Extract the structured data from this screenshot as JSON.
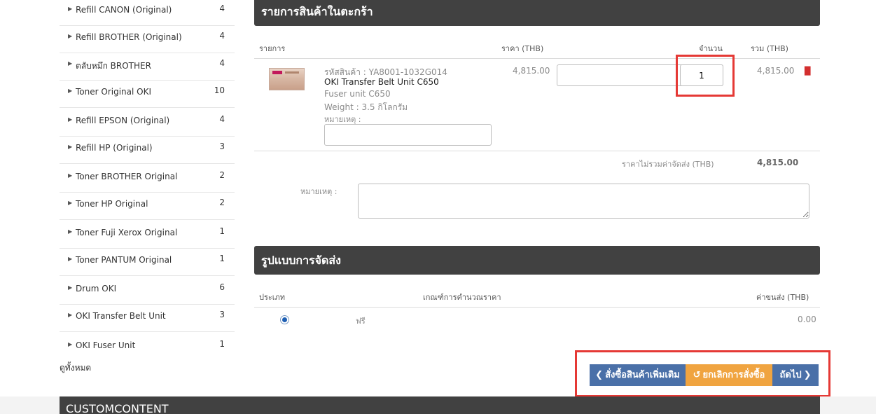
{
  "sidebar": {
    "categories": [
      {
        "label": "Refill CANON (Original)",
        "count": "4"
      },
      {
        "label": "Refill BROTHER (Original)",
        "count": "4"
      },
      {
        "label": "ตลับหมึก BROTHER",
        "count": "4"
      },
      {
        "label": "Toner Original OKI",
        "count": "10"
      },
      {
        "label": "Refill EPSON (Original)",
        "count": "4"
      },
      {
        "label": "Refill HP (Original)",
        "count": "3"
      },
      {
        "label": "Toner BROTHER Original",
        "count": "2"
      },
      {
        "label": "Toner HP Original",
        "count": "2"
      },
      {
        "label": "Toner Fuji Xerox Original",
        "count": "1"
      },
      {
        "label": "Toner PANTUM Original",
        "count": "1"
      },
      {
        "label": "Drum OKI",
        "count": "6"
      },
      {
        "label": "OKI Transfer Belt Unit",
        "count": "3"
      },
      {
        "label": "OKI Fuser Unit",
        "count": "1"
      }
    ],
    "view_all": "ดูทั้งหมด"
  },
  "cart": {
    "title": "รายการสินค้าในตะกร้า",
    "columns": {
      "item": "รายการ",
      "price": "ราคา (THB)",
      "qty": "จำนวน",
      "total": "รวม (THB)"
    },
    "item": {
      "code_label": "รหัสสินค้า :",
      "code": "YA8001-1032G014",
      "name": "OKI Transfer Belt Unit C650",
      "desc": "Fuser unit C650",
      "weight": "Weight : 3.5 กิโลกรัม",
      "note_label": "หมายเหตุ :",
      "note_value": "",
      "price": "4,815.00",
      "qty": "1",
      "total": "4,815.00"
    },
    "subtotal_label": "ราคาไม่รวมค่าจัดส่ง (THB)",
    "subtotal_value": "4,815.00",
    "order_note_label": "หมายเหตุ :",
    "order_note_value": ""
  },
  "shipping": {
    "title": "รูปแบบการจัดส่ง",
    "columns": {
      "type": "ประเภท",
      "criteria": "เกณฑ์การคำนวณราคา",
      "fee": "ค่าขนส่ง (THB)"
    },
    "option": {
      "name": "ฟรี",
      "fee": "0.00",
      "selected": true
    }
  },
  "actions": {
    "continue_shopping": "สั่งซื้อสินค้าเพิ่มเติม",
    "cancel_order": "ยกเลิกการสั่งซื้อ",
    "next": "ถัดไป"
  },
  "footer": {
    "custom_title": "CUSTOMCONTENT"
  },
  "colors": {
    "panel_header": "#414141",
    "primary_button": "#4a70a8",
    "cancel_button": "#f0a440",
    "highlight": "#e53935",
    "delete_icon": "#d32f2f"
  }
}
